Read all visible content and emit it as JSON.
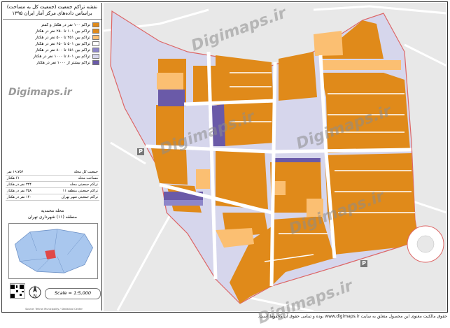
{
  "legend": {
    "title_lines": [
      "نقشه تراکم جمعیت (جمعیت کل به مساحت)",
      "براساس داده‌های مرکز آمار ایران ۱۳۹۵"
    ],
    "items": [
      {
        "label": "تراکم ۱۰۰ نفر در هکتار و کمتر",
        "color": "#e08a1a"
      },
      {
        "label": "تراکم بین ۱۰۱ تا ۲۵۰ نفر در هکتار",
        "color": "#e08a1a"
      },
      {
        "label": "تراکم بین ۲۵۱ تا ۵۰۰ نفر در هکتار",
        "color": "#fbbf72"
      },
      {
        "label": "تراکم بین ۵۰۱ تا ۶۵۰ نفر در هکتار",
        "color": "#ffffff"
      },
      {
        "label": "تراکم بین ۶۵۱ تا ۸۰۰ نفر در هکتار",
        "color": "#8d86c9"
      },
      {
        "label": "تراکم بین ۸۰۱ تا ۱۰۰۰ نفر در هکتار",
        "color": "#d6d6ec"
      },
      {
        "label": "تراکم بیشتر از ۱۰۰۰ نفر در هکتار",
        "color": "#6a5aa8"
      }
    ]
  },
  "stats": [
    {
      "label": "جمعیت کل محله",
      "value": "۱۹،۷۵۶ نفر"
    },
    {
      "label": "مساحت محله",
      "value": "۶۱ هکتار"
    },
    {
      "label": "تراکم جمعیتی محله",
      "value": "۳۲۴ نفر در هکتار"
    },
    {
      "label": "تراکم جمعیتی منطقه ۱۱",
      "value": "۳۵۸ نفر در هکتار"
    },
    {
      "label": "تراکم جمعیتی شهر تهران",
      "value": "۱۴۰ نفر در هکتار"
    }
  ],
  "district": {
    "line1": "محله محمدیه",
    "line2": "منطقه (۱۱) شهرداری تهران"
  },
  "scale_label": "Scale = 1:5,000",
  "north_label": "N",
  "footer_small": "Source: Tehran Municipality / Statistical Center",
  "watermark": "Digimaps.ir",
  "map_labels": [
    {
      "name": "parking-1",
      "text": "P"
    },
    {
      "name": "parking-2",
      "text": "P"
    }
  ],
  "copyright": "حقوق مالکیت معنوی این محصول متعلق به سایت www.digimaps.ir بوده و تمامی حقوق آن محفوظ است.",
  "colors": {
    "orange": "#e08a1a",
    "light_orange": "#fbbf72",
    "lavender": "#d6d6ec",
    "purple": "#6a5aa8",
    "mid_purple": "#8d86c9",
    "road": "#ffffff",
    "bg": "#e7e7e7"
  }
}
